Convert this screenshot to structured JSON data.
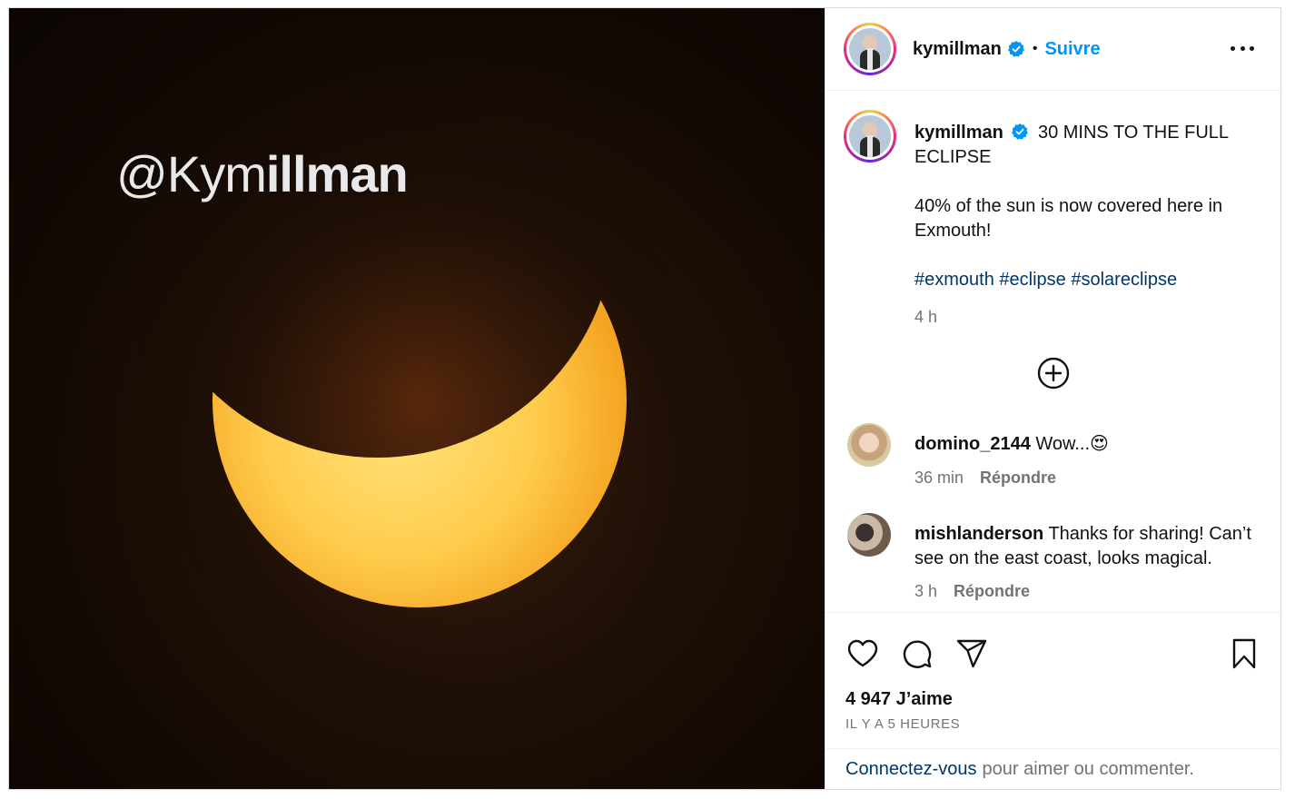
{
  "post": {
    "watermark_prefix": "@Kym",
    "watermark_bold": "illman",
    "username": "kymillman",
    "follow_label": "Suivre",
    "dot": "•"
  },
  "caption": {
    "username": "kymillman",
    "line1": "30 MINS TO THE FULL ECLIPSE",
    "line2": "40% of the sun is now covered here in Exmouth!",
    "hashtags": [
      "#exmouth",
      "#eclipse",
      "#solareclipse"
    ],
    "time": "4 h"
  },
  "comments": [
    {
      "username": "domino_2144",
      "text": "Wow...",
      "emoji": "😍",
      "time": "36 min",
      "reply_label": "Répondre"
    },
    {
      "username": "mishlanderson",
      "text": "Thanks for sharing! Can’t see on the east coast, looks magical.",
      "time": "3 h",
      "reply_label": "Répondre"
    }
  ],
  "stats": {
    "likes": "4 947 J’aime",
    "ago": "IL Y A 5 HEURES"
  },
  "login": {
    "link_label": "Connectez-vous",
    "rest": "pour aimer ou commenter."
  },
  "colors": {
    "accent": "#0095f6",
    "link": "#00376b",
    "muted": "#737373",
    "sun_light": "#ffd76a",
    "sun_dark": "#f6a21a"
  },
  "icons": {
    "verified": "verified-badge-icon",
    "more": "more-horizontal-icon",
    "load_more": "plus-circle-icon",
    "like": "heart-icon",
    "comment": "comment-bubble-icon",
    "share": "paper-plane-icon",
    "save": "bookmark-icon"
  }
}
